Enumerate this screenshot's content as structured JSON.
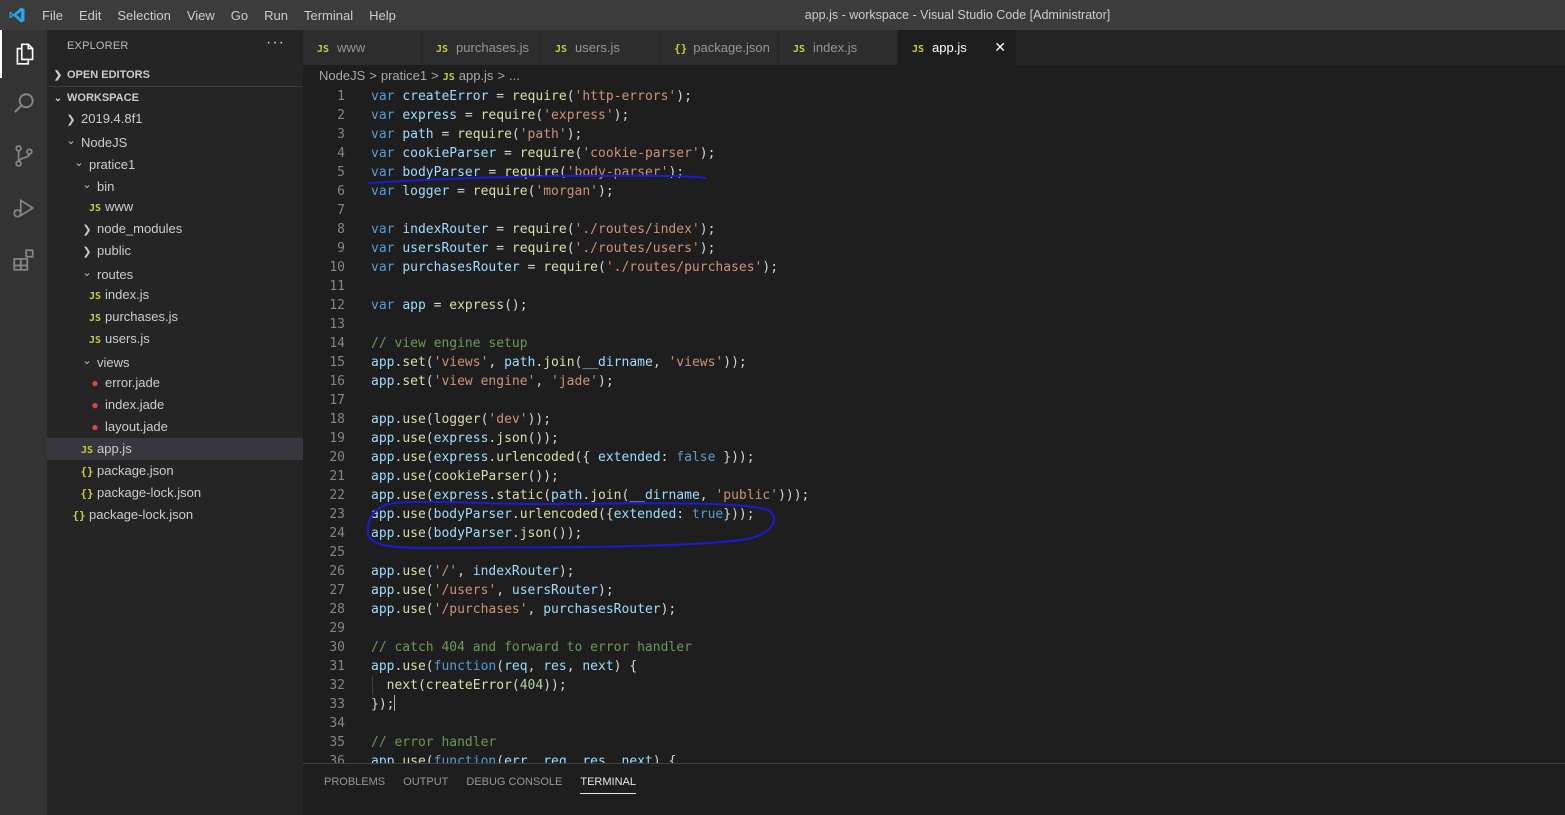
{
  "app": {
    "window_title": "app.js - workspace - Visual Studio Code [Administrator]",
    "menu": [
      "File",
      "Edit",
      "Selection",
      "View",
      "Go",
      "Run",
      "Terminal",
      "Help"
    ],
    "accent_color": "#007acc"
  },
  "activity_bar": [
    {
      "icon": "files-icon",
      "active": true
    },
    {
      "icon": "search-icon",
      "active": false
    },
    {
      "icon": "source-control-icon",
      "active": false
    },
    {
      "icon": "run-debug-icon",
      "active": false
    },
    {
      "icon": "extensions-icon",
      "active": false
    }
  ],
  "explorer": {
    "title": "EXPLORER",
    "more_actions": "···",
    "open_editors_label": "OPEN EDITORS",
    "workspace_label": "WORKSPACE",
    "tree": [
      {
        "label": "2019.4.8f1",
        "type": "folder-collapsed"
      },
      {
        "label": "NodeJS",
        "type": "folder-open"
      },
      {
        "label": "pratice1",
        "type": "folder-open"
      },
      {
        "label": "bin",
        "type": "folder-open"
      },
      {
        "label": "www",
        "type": "js",
        "badge": "JS"
      },
      {
        "label": "node_modules",
        "type": "folder-collapsed"
      },
      {
        "label": "public",
        "type": "folder-collapsed"
      },
      {
        "label": "routes",
        "type": "folder-open"
      },
      {
        "label": "index.js",
        "type": "js",
        "badge": "JS"
      },
      {
        "label": "purchases.js",
        "type": "js",
        "badge": "JS"
      },
      {
        "label": "users.js",
        "type": "js",
        "badge": "JS"
      },
      {
        "label": "views",
        "type": "folder-open"
      },
      {
        "label": "error.jade",
        "type": "jade"
      },
      {
        "label": "index.jade",
        "type": "jade"
      },
      {
        "label": "layout.jade",
        "type": "jade"
      },
      {
        "label": "app.js",
        "type": "js",
        "badge": "JS",
        "selected": true
      },
      {
        "label": "package.json",
        "type": "json",
        "badge": "{}"
      },
      {
        "label": "package-lock.json",
        "type": "json",
        "badge": "{}"
      },
      {
        "label": "package-lock.json",
        "type": "json",
        "badge": "{}"
      }
    ]
  },
  "tabs": [
    {
      "label": "www",
      "badge": "JS"
    },
    {
      "label": "purchases.js",
      "badge": "JS"
    },
    {
      "label": "users.js",
      "badge": "JS"
    },
    {
      "label": "package.json",
      "badge": "{}"
    },
    {
      "label": "index.js",
      "badge": "JS"
    },
    {
      "label": "app.js",
      "badge": "JS",
      "active": true,
      "close": "✕"
    }
  ],
  "breadcrumb": {
    "parts": [
      "NodeJS",
      "pratice1",
      "app.js",
      "..."
    ],
    "separator": ">",
    "badge": "JS"
  },
  "code_lines": [
    [
      [
        "k",
        "var "
      ],
      [
        "v",
        "createError"
      ],
      [
        "p",
        " = "
      ],
      [
        "f",
        "require"
      ],
      [
        "p",
        "("
      ],
      [
        "s",
        "'http-errors'"
      ],
      [
        "p",
        ");"
      ]
    ],
    [
      [
        "k",
        "var "
      ],
      [
        "v",
        "express"
      ],
      [
        "p",
        " = "
      ],
      [
        "f",
        "require"
      ],
      [
        "p",
        "("
      ],
      [
        "s",
        "'express'"
      ],
      [
        "p",
        ");"
      ]
    ],
    [
      [
        "k",
        "var "
      ],
      [
        "v",
        "path"
      ],
      [
        "p",
        " = "
      ],
      [
        "f",
        "require"
      ],
      [
        "p",
        "("
      ],
      [
        "s",
        "'path'"
      ],
      [
        "p",
        ");"
      ]
    ],
    [
      [
        "k",
        "var "
      ],
      [
        "v",
        "cookieParser"
      ],
      [
        "p",
        " = "
      ],
      [
        "f",
        "require"
      ],
      [
        "p",
        "("
      ],
      [
        "s",
        "'cookie-parser'"
      ],
      [
        "p",
        ");"
      ]
    ],
    [
      [
        "k",
        "var "
      ],
      [
        "v",
        "bodyParser"
      ],
      [
        "p",
        " = "
      ],
      [
        "f",
        "require"
      ],
      [
        "p",
        "("
      ],
      [
        "s",
        "'body-parser'"
      ],
      [
        "p",
        ");"
      ]
    ],
    [
      [
        "k",
        "var "
      ],
      [
        "v",
        "logger"
      ],
      [
        "p",
        " = "
      ],
      [
        "f",
        "require"
      ],
      [
        "p",
        "("
      ],
      [
        "s",
        "'morgan'"
      ],
      [
        "p",
        ");"
      ]
    ],
    [],
    [
      [
        "k",
        "var "
      ],
      [
        "v",
        "indexRouter"
      ],
      [
        "p",
        " = "
      ],
      [
        "f",
        "require"
      ],
      [
        "p",
        "("
      ],
      [
        "s",
        "'./routes/index'"
      ],
      [
        "p",
        ");"
      ]
    ],
    [
      [
        "k",
        "var "
      ],
      [
        "v",
        "usersRouter"
      ],
      [
        "p",
        " = "
      ],
      [
        "f",
        "require"
      ],
      [
        "p",
        "("
      ],
      [
        "s",
        "'./routes/users'"
      ],
      [
        "p",
        ");"
      ]
    ],
    [
      [
        "k",
        "var "
      ],
      [
        "v",
        "purchasesRouter"
      ],
      [
        "p",
        " = "
      ],
      [
        "f",
        "require"
      ],
      [
        "p",
        "("
      ],
      [
        "s",
        "'./routes/purchases'"
      ],
      [
        "p",
        ");"
      ]
    ],
    [],
    [
      [
        "k",
        "var "
      ],
      [
        "v",
        "app"
      ],
      [
        "p",
        " = "
      ],
      [
        "f",
        "express"
      ],
      [
        "p",
        "();"
      ]
    ],
    [],
    [
      [
        "c",
        "// view engine setup"
      ]
    ],
    [
      [
        "v",
        "app"
      ],
      [
        "p",
        "."
      ],
      [
        "f",
        "set"
      ],
      [
        "p",
        "("
      ],
      [
        "s",
        "'views'"
      ],
      [
        "p",
        ", "
      ],
      [
        "v",
        "path"
      ],
      [
        "p",
        "."
      ],
      [
        "f",
        "join"
      ],
      [
        "p",
        "("
      ],
      [
        "v",
        "__dirname"
      ],
      [
        "p",
        ", "
      ],
      [
        "s",
        "'views'"
      ],
      [
        "p",
        "));"
      ]
    ],
    [
      [
        "v",
        "app"
      ],
      [
        "p",
        "."
      ],
      [
        "f",
        "set"
      ],
      [
        "p",
        "("
      ],
      [
        "s",
        "'view engine'"
      ],
      [
        "p",
        ", "
      ],
      [
        "s",
        "'jade'"
      ],
      [
        "p",
        ");"
      ]
    ],
    [],
    [
      [
        "v",
        "app"
      ],
      [
        "p",
        "."
      ],
      [
        "f",
        "use"
      ],
      [
        "p",
        "("
      ],
      [
        "f",
        "logger"
      ],
      [
        "p",
        "("
      ],
      [
        "s",
        "'dev'"
      ],
      [
        "p",
        "));"
      ]
    ],
    [
      [
        "v",
        "app"
      ],
      [
        "p",
        "."
      ],
      [
        "f",
        "use"
      ],
      [
        "p",
        "("
      ],
      [
        "v",
        "express"
      ],
      [
        "p",
        "."
      ],
      [
        "f",
        "json"
      ],
      [
        "p",
        "());"
      ]
    ],
    [
      [
        "v",
        "app"
      ],
      [
        "p",
        "."
      ],
      [
        "f",
        "use"
      ],
      [
        "p",
        "("
      ],
      [
        "v",
        "express"
      ],
      [
        "p",
        "."
      ],
      [
        "f",
        "urlencoded"
      ],
      [
        "p",
        "({ "
      ],
      [
        "v",
        "extended"
      ],
      [
        "p",
        ": "
      ],
      [
        "k",
        "false"
      ],
      [
        "p",
        " }));"
      ]
    ],
    [
      [
        "v",
        "app"
      ],
      [
        "p",
        "."
      ],
      [
        "f",
        "use"
      ],
      [
        "p",
        "("
      ],
      [
        "f",
        "cookieParser"
      ],
      [
        "p",
        "());"
      ]
    ],
    [
      [
        "v",
        "app"
      ],
      [
        "p",
        "."
      ],
      [
        "f",
        "use"
      ],
      [
        "p",
        "("
      ],
      [
        "v",
        "express"
      ],
      [
        "p",
        "."
      ],
      [
        "f",
        "static"
      ],
      [
        "p",
        "("
      ],
      [
        "v",
        "path"
      ],
      [
        "p",
        "."
      ],
      [
        "f",
        "join"
      ],
      [
        "p",
        "("
      ],
      [
        "v",
        "__dirname"
      ],
      [
        "p",
        ", "
      ],
      [
        "s",
        "'public'"
      ],
      [
        "p",
        ")));"
      ]
    ],
    [
      [
        "v",
        "app"
      ],
      [
        "p",
        "."
      ],
      [
        "f",
        "use"
      ],
      [
        "p",
        "("
      ],
      [
        "v",
        "bodyParser"
      ],
      [
        "p",
        "."
      ],
      [
        "f",
        "urlencoded"
      ],
      [
        "p",
        "({"
      ],
      [
        "v",
        "extended"
      ],
      [
        "p",
        ": "
      ],
      [
        "k",
        "true"
      ],
      [
        "p",
        "}));"
      ]
    ],
    [
      [
        "v",
        "app"
      ],
      [
        "p",
        "."
      ],
      [
        "f",
        "use"
      ],
      [
        "p",
        "("
      ],
      [
        "v",
        "bodyParser"
      ],
      [
        "p",
        "."
      ],
      [
        "f",
        "json"
      ],
      [
        "p",
        "());"
      ]
    ],
    [],
    [
      [
        "v",
        "app"
      ],
      [
        "p",
        "."
      ],
      [
        "f",
        "use"
      ],
      [
        "p",
        "("
      ],
      [
        "s",
        "'/'"
      ],
      [
        "p",
        ", "
      ],
      [
        "v",
        "indexRouter"
      ],
      [
        "p",
        ");"
      ]
    ],
    [
      [
        "v",
        "app"
      ],
      [
        "p",
        "."
      ],
      [
        "f",
        "use"
      ],
      [
        "p",
        "("
      ],
      [
        "s",
        "'/users'"
      ],
      [
        "p",
        ", "
      ],
      [
        "v",
        "usersRouter"
      ],
      [
        "p",
        ");"
      ]
    ],
    [
      [
        "v",
        "app"
      ],
      [
        "p",
        "."
      ],
      [
        "f",
        "use"
      ],
      [
        "p",
        "("
      ],
      [
        "s",
        "'/purchases'"
      ],
      [
        "p",
        ", "
      ],
      [
        "v",
        "purchasesRouter"
      ],
      [
        "p",
        ");"
      ]
    ],
    [],
    [
      [
        "c",
        "// catch 404 and forward to error handler"
      ]
    ],
    [
      [
        "v",
        "app"
      ],
      [
        "p",
        "."
      ],
      [
        "f",
        "use"
      ],
      [
        "p",
        "("
      ],
      [
        "k",
        "function"
      ],
      [
        "p",
        "("
      ],
      [
        "v",
        "req"
      ],
      [
        "p",
        ", "
      ],
      [
        "v",
        "res"
      ],
      [
        "p",
        ", "
      ],
      [
        "v",
        "next"
      ],
      [
        "p",
        ") {"
      ]
    ],
    [
      [
        "p",
        "  "
      ],
      [
        "f",
        "next"
      ],
      [
        "p",
        "("
      ],
      [
        "f",
        "createError"
      ],
      [
        "p",
        "("
      ],
      [
        "n",
        "404"
      ],
      [
        "p",
        "));"
      ]
    ],
    [
      [
        "p",
        "});"
      ]
    ],
    [],
    [
      [
        "c",
        "// error handler"
      ]
    ],
    [
      [
        "v",
        "app"
      ],
      [
        "p",
        "."
      ],
      [
        "f",
        "use"
      ],
      [
        "p",
        "("
      ],
      [
        "k",
        "function"
      ],
      [
        "p",
        "("
      ],
      [
        "v",
        "err"
      ],
      [
        "p",
        ", "
      ],
      [
        "v",
        "req"
      ],
      [
        "p",
        ", "
      ],
      [
        "v",
        "res"
      ],
      [
        "p",
        ", "
      ],
      [
        "v",
        "next"
      ],
      [
        "p",
        ") {"
      ]
    ]
  ],
  "cursor_line": 33,
  "panel": {
    "tabs": [
      "PROBLEMS",
      "OUTPUT",
      "DEBUG CONSOLE",
      "TERMINAL"
    ],
    "active_tab": "TERMINAL"
  }
}
